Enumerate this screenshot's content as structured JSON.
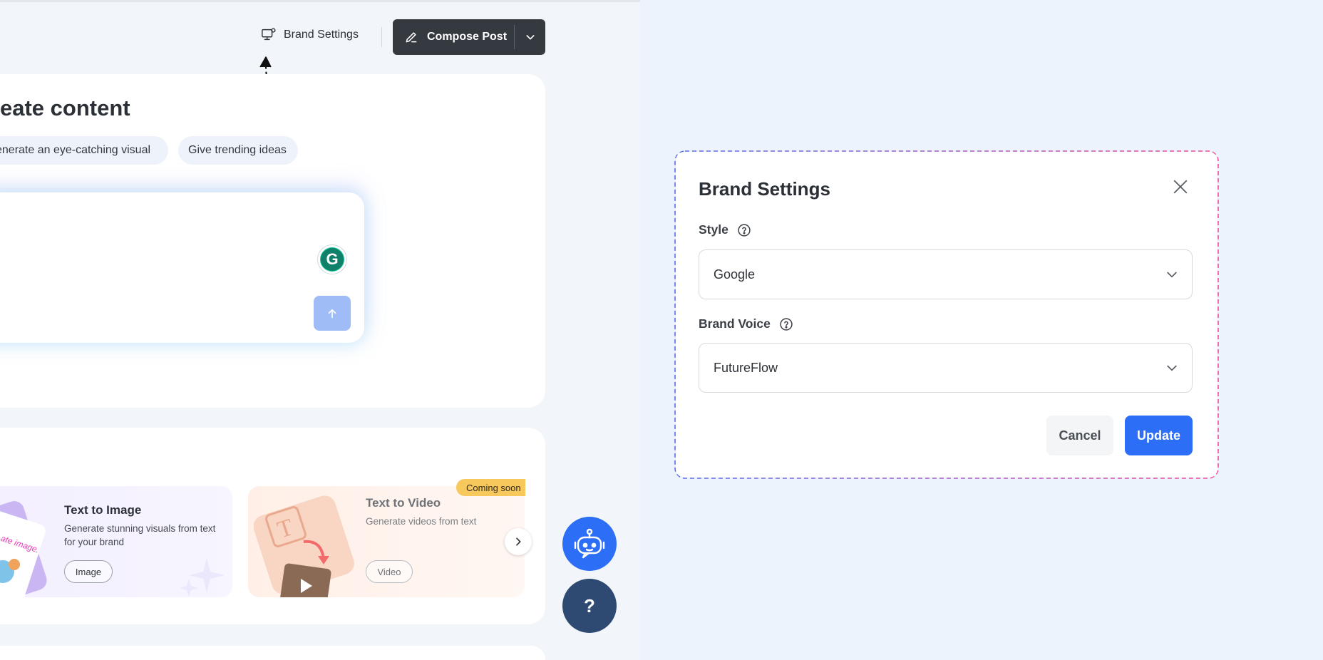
{
  "header": {
    "brand_settings_label": "Brand Settings",
    "compose_label": "Compose Post"
  },
  "create": {
    "title": "eate content",
    "chips": [
      "enerate an eye-catching visual",
      "Give trending ideas"
    ]
  },
  "grammarly": {
    "letter": "G"
  },
  "features": [
    {
      "title": "Text to Image",
      "description": "Generate stunning visuals from text for your brand",
      "button": "Image",
      "thumb_text": "ate image."
    },
    {
      "title": "Text to Video",
      "description": "Generate videos from text",
      "button": "Video",
      "badge": "Coming soon",
      "thumb_text": "T"
    }
  ],
  "help": {
    "label": "?"
  },
  "modal": {
    "title": "Brand Settings",
    "style_label": "Style",
    "style_value": "Google",
    "voice_label": "Brand Voice",
    "voice_value": "FutureFlow",
    "cancel_label": "Cancel",
    "update_label": "Update"
  },
  "colors": {
    "primary": "#2d6ef6",
    "dark_button": "#353a40",
    "help_button": "#2f4a72",
    "badge": "#f7c85c",
    "modal_border_start": "#5b6ee8",
    "modal_border_end": "#ec4f9a"
  },
  "icons": {
    "brand_settings": "monitor-gear-icon",
    "compose": "pencil-icon",
    "dropdown": "chevron-down-icon",
    "send": "arrow-up-icon",
    "next": "chevron-right-icon",
    "bot": "robot-icon",
    "close": "close-icon",
    "help": "question-circle-icon"
  }
}
